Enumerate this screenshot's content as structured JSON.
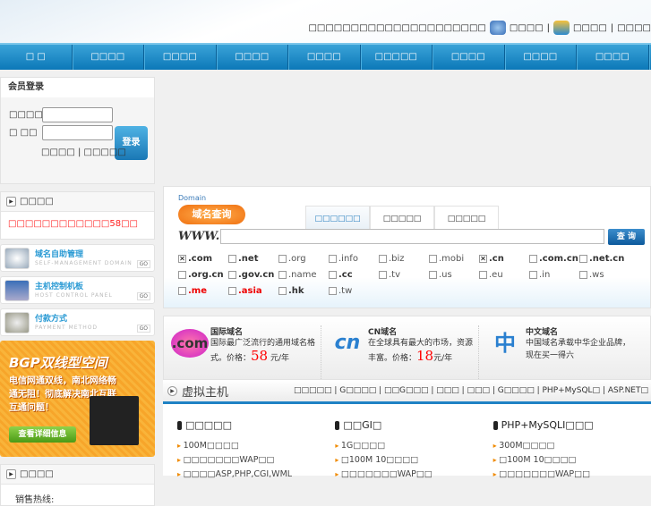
{
  "header": {
    "tagline": "□□□□□□□□□□□□□□□□□□□□□",
    "links": [
      "□□□□",
      "□□□□",
      "□□□□"
    ]
  },
  "nav": [
    "□ □",
    "□□□□",
    "□□□□",
    "□□□□",
    "□□□□",
    "□□□□□",
    "□□□□",
    "□□□□",
    "□□□□"
  ],
  "login": {
    "title": "会员登录",
    "user_label": "□□□□",
    "pass_label": "□ □□",
    "button": "登录",
    "forgot": "□□□□",
    "register": "□□□□□"
  },
  "notice": {
    "title": "□□□□",
    "text": "□□□□□□□□□□□□58□□"
  },
  "quicklinks": [
    {
      "title": "域名自助管理",
      "sub": "SELF-MANAGEMENT DOMAIN",
      "go": "GO"
    },
    {
      "title": "主机控制机板",
      "sub": "HOST CONTROL PANEL",
      "go": "GO"
    },
    {
      "title": "付款方式",
      "sub": "PAYMENT METHOD",
      "go": "GO"
    }
  ],
  "banner": {
    "title": "BGP双线型空间",
    "desc": "电信网通双线，南北网络畅通无阻！彻底解决南北互联互通问题！",
    "button": "查看详细信息"
  },
  "contact": {
    "title": "□□□□",
    "hotline": "销售热线:"
  },
  "domain": {
    "logo_en": "Domain",
    "logo_cn": "域名查询",
    "tabs": [
      "□□□□□□",
      "□□□□□",
      "□□□□□"
    ],
    "www": "WWW.",
    "input_value": "",
    "button": "查 询",
    "tlds": [
      {
        "name": ".com",
        "checked": true,
        "style": "b"
      },
      {
        "name": ".net",
        "checked": false,
        "style": "b"
      },
      {
        "name": ".org",
        "checked": false,
        "style": ""
      },
      {
        "name": ".info",
        "checked": false,
        "style": ""
      },
      {
        "name": ".biz",
        "checked": false,
        "style": ""
      },
      {
        "name": ".mobi",
        "checked": false,
        "style": ""
      },
      {
        "name": ".cn",
        "checked": true,
        "style": "b"
      },
      {
        "name": ".com.cn",
        "checked": false,
        "style": "b"
      },
      {
        "name": ".net.cn",
        "checked": false,
        "style": "b"
      },
      {
        "name": ".org.cn",
        "checked": false,
        "style": "b"
      },
      {
        "name": ".gov.cn",
        "checked": false,
        "style": "b"
      },
      {
        "name": ".name",
        "checked": false,
        "style": ""
      },
      {
        "name": ".cc",
        "checked": false,
        "style": "b"
      },
      {
        "name": ".tv",
        "checked": false,
        "style": ""
      },
      {
        "name": ".us",
        "checked": false,
        "style": ""
      },
      {
        "name": ".eu",
        "checked": false,
        "style": ""
      },
      {
        "name": ".in",
        "checked": false,
        "style": ""
      },
      {
        "name": ".ws",
        "checked": false,
        "style": ""
      },
      {
        "name": ".me",
        "checked": false,
        "style": "r"
      },
      {
        "name": ".asia",
        "checked": false,
        "style": "r"
      },
      {
        "name": ".hk",
        "checked": false,
        "style": "b"
      },
      {
        "name": ".tw",
        "checked": false,
        "style": ""
      }
    ]
  },
  "promos": [
    {
      "logo": ".com",
      "title": "国际域名",
      "desc": "国际最广泛流行的通用域名格式。价格：",
      "price": "58",
      "unit": "元/年"
    },
    {
      "logo": "cn",
      "title": "CN域名",
      "desc": "在全球具有最大的市场，资源丰富。价格：",
      "price": "18",
      "unit": "元/年"
    },
    {
      "logo": "中",
      "title": "中文域名",
      "desc": "中国域名承载中华企业品牌，现在买一得六",
      "price": "",
      "unit": ""
    }
  ],
  "hosting": {
    "title": "虚拟主机",
    "links": "□□□□□ | G□□□□ | □□G□□□ | □□□ | □□□ | G□□□□ | PHP+MySQL□ | ASP.NET□",
    "plans": [
      {
        "name": "□□□□□",
        "features": [
          "100M□□□□",
          "□□□□□□□WAP□□",
          "□□□□ASP,PHP,CGI,WML"
        ]
      },
      {
        "name": "□□GI□",
        "features": [
          "1G□□□□",
          "□100M 10□□□□",
          "□□□□□□□WAP□□"
        ]
      },
      {
        "name": "PHP+MySQLI□□□",
        "features": [
          "300M□□□□",
          "□100M 10□□□□",
          "□□□□□□□WAP□□"
        ]
      }
    ]
  }
}
